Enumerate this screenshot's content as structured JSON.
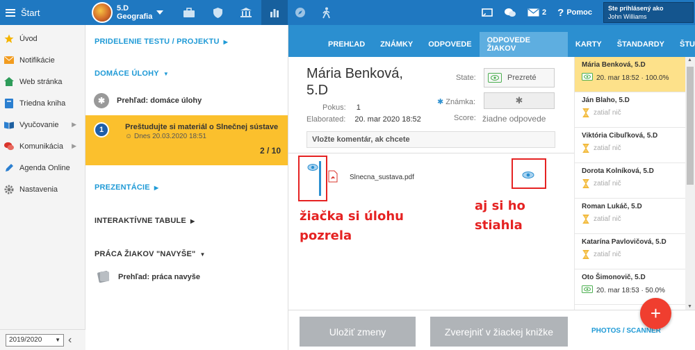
{
  "topbar": {
    "start_label": "Štart",
    "class_name": "5.D",
    "subject": "Geografia",
    "messages_count": "2",
    "help_label": "Pomoc",
    "login_title": "Ste prihlásený ako",
    "login_user": "John Williams"
  },
  "sidebar": {
    "items": [
      {
        "label": "Úvod",
        "icon": "star-icon"
      },
      {
        "label": "Notifikácie",
        "icon": "envelope-icon"
      },
      {
        "label": "Web stránka",
        "icon": "house-icon"
      },
      {
        "label": "Triedna kniha",
        "icon": "book-icon"
      },
      {
        "label": "Vyučovanie",
        "icon": "open-book-icon"
      },
      {
        "label": "Komunikácia",
        "icon": "chat-icon"
      },
      {
        "label": "Agenda Online",
        "icon": "pencil-icon"
      },
      {
        "label": "Nastavenia",
        "icon": "gear-icon"
      }
    ],
    "year": "2019/2020"
  },
  "assignments": {
    "section_test": "PRIDELENIE TESTU / PROJEKTU",
    "section_homework": "DOMÁCE ÚLOHY",
    "overview_hw": "Prehľad: domáce úlohy",
    "hw_number": "1",
    "hw_title": "Preštudujte si materiál o Slnečnej sústave",
    "hw_date": "Dnes 20.03.2020 18:51",
    "hw_count": "2 / 10",
    "section_presentations": "PREZENTÁCIE",
    "section_boards": "INTERAKTÍVNE TABULE",
    "section_extra": "PRÁCA ŽIAKOV \"NAVYŠE\"",
    "overview_extra": "Prehľad: práca navyše"
  },
  "tabs": [
    "PREHĽAD",
    "ZNÁMKY",
    "ODPOVEDE",
    "ODPOVEDE ŽIAKOV",
    "KARTY",
    "ŠTANDARDY",
    "ŠTU"
  ],
  "active_tab": 3,
  "detail": {
    "student_name_line1": "Mária Benková,",
    "student_name_line2": "5.D",
    "attempt_label": "Pokus:",
    "attempt_value": "1",
    "elaborated_label": "Elaborated:",
    "elaborated_value": "20. mar 2020 18:52",
    "state_label": "State:",
    "state_value": "Prezreté",
    "grade_label": "Známka:",
    "score_label": "Score:",
    "score_value": "žiadne odpovede",
    "comment_placeholder": "Vložte komentár, ak chcete",
    "file_name": "Slnecna_sustava.pdf"
  },
  "annotations": {
    "left_line1": "žiačka si úlohu",
    "left_line2": "pozrela",
    "right": "aj si ho stiahla"
  },
  "students": [
    {
      "name": "Mária Benková, 5.D",
      "status": "20. mar 18:52 · 100.0%",
      "viewed": true,
      "selected": true
    },
    {
      "name": "Ján Blaho, 5.D",
      "status": "zatiaľ nič",
      "viewed": false
    },
    {
      "name": "Viktória Cibuľková, 5.D",
      "status": "zatiaľ nič",
      "viewed": false
    },
    {
      "name": "Dorota Kolníková, 5.D",
      "status": "zatiaľ nič",
      "viewed": false
    },
    {
      "name": "Roman Lukáč, 5.D",
      "status": "zatiaľ nič",
      "viewed": false
    },
    {
      "name": "Katarína Pavlovičová, 5.D",
      "status": "zatiaľ nič",
      "viewed": false
    },
    {
      "name": "Oto Šimonovič, 5.D",
      "status": "20. mar 18:53 · 50.0%",
      "viewed": true
    }
  ],
  "footer": {
    "save_label": "Uložiť zmeny",
    "publish_label": "Zverejniť v žiackej knižke",
    "photos_label": "PHOTOS / SCANNER",
    "fab_label": "+"
  },
  "colors": {
    "brand_blue": "#1f78c1",
    "highlight": "#fbc02d",
    "annotation_red": "#e52222"
  }
}
